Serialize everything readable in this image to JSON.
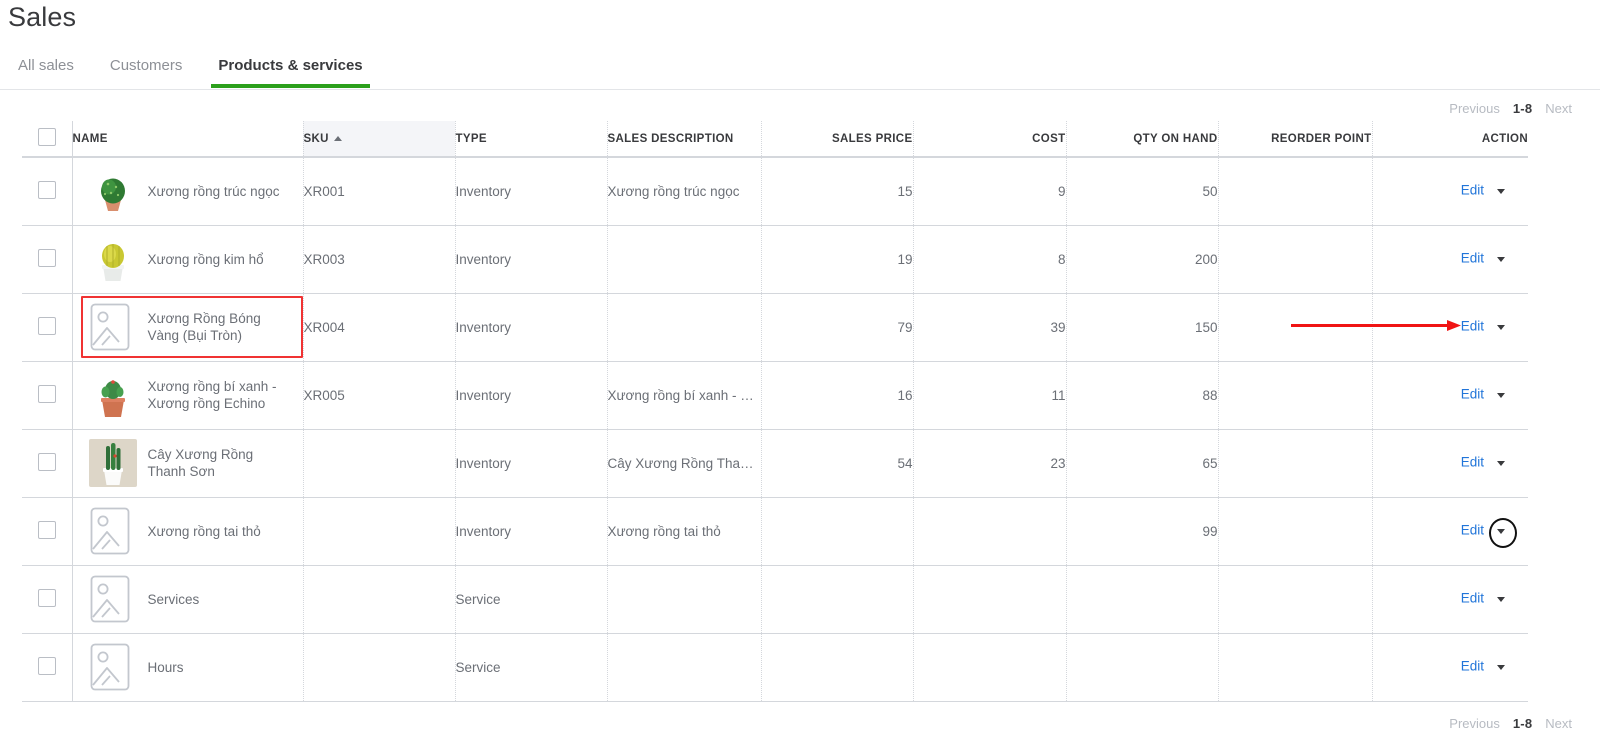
{
  "header": {
    "title": "Sales"
  },
  "tabs": [
    {
      "label": "All sales",
      "active": false
    },
    {
      "label": "Customers",
      "active": false
    },
    {
      "label": "Products & services",
      "active": true
    }
  ],
  "accent_color": "#2ca01c",
  "link_color": "#2175d9",
  "highlight_color": "#f03333",
  "pagination": {
    "previous": "Previous",
    "range": "1-8",
    "next": "Next"
  },
  "table": {
    "columns": [
      {
        "key": "name",
        "label": "NAME",
        "align": "left",
        "sorted": false
      },
      {
        "key": "sku",
        "label": "SKU",
        "align": "left",
        "sorted": true,
        "sort_dir": "asc"
      },
      {
        "key": "type",
        "label": "TYPE",
        "align": "left",
        "sorted": false
      },
      {
        "key": "description",
        "label": "SALES DESCRIPTION",
        "align": "left",
        "sorted": false
      },
      {
        "key": "price",
        "label": "SALES PRICE",
        "align": "right",
        "sorted": false
      },
      {
        "key": "cost",
        "label": "COST",
        "align": "right",
        "sorted": false
      },
      {
        "key": "qty",
        "label": "QTY ON HAND",
        "align": "right",
        "sorted": false
      },
      {
        "key": "reorder",
        "label": "REORDER POINT",
        "align": "right",
        "sorted": false
      },
      {
        "key": "action",
        "label": "ACTION",
        "align": "right",
        "sorted": false
      }
    ],
    "action_label": "Edit",
    "rows": [
      {
        "name": "Xương rồng trúc ngọc",
        "thumb": "cactus-green-ball",
        "sku": "XR001",
        "type": "Inventory",
        "description": "Xương rồng trúc ngọc",
        "price": "15",
        "cost": "9",
        "qty": "50",
        "reorder": "",
        "highlighted": false,
        "caret_ringed": false
      },
      {
        "name": "Xương rồng kim hổ",
        "thumb": "cactus-yellow-barrel",
        "sku": "XR003",
        "type": "Inventory",
        "description": "",
        "price": "19",
        "cost": "8",
        "qty": "200",
        "reorder": "",
        "highlighted": false,
        "caret_ringed": false
      },
      {
        "name": "Xương Rồng Bóng Vàng (Bụi Tròn)",
        "thumb": "placeholder-image",
        "sku": "XR004",
        "type": "Inventory",
        "description": "",
        "price": "79",
        "cost": "39",
        "qty": "150",
        "reorder": "",
        "highlighted": true,
        "caret_ringed": false
      },
      {
        "name": "Xương rồng bí xanh - Xương rồng Echino",
        "thumb": "cactus-terracotta-pot",
        "sku": "XR005",
        "type": "Inventory",
        "description": "Xương rồng bí xanh - …",
        "price": "16",
        "cost": "11",
        "qty": "88",
        "reorder": "",
        "highlighted": false,
        "caret_ringed": false
      },
      {
        "name": "Cây Xương Rồng Thanh Sơn",
        "thumb": "cactus-tall-white-pot",
        "sku": "",
        "type": "Inventory",
        "description": "Cây Xương Rồng Than…",
        "price": "54",
        "cost": "23",
        "qty": "65",
        "reorder": "",
        "highlighted": false,
        "caret_ringed": false
      },
      {
        "name": "Xương rồng tai thỏ",
        "thumb": "placeholder-image",
        "sku": "",
        "type": "Inventory",
        "description": "Xương rồng tai thỏ",
        "price": "",
        "cost": "",
        "qty": "99",
        "reorder": "",
        "highlighted": false,
        "caret_ringed": true
      },
      {
        "name": "Services",
        "thumb": "placeholder-image",
        "sku": "",
        "type": "Service",
        "description": "",
        "price": "",
        "cost": "",
        "qty": "",
        "reorder": "",
        "highlighted": false,
        "caret_ringed": false
      },
      {
        "name": "Hours",
        "thumb": "placeholder-image",
        "sku": "",
        "type": "Service",
        "description": "",
        "price": "",
        "cost": "",
        "qty": "",
        "reorder": "",
        "highlighted": false,
        "caret_ringed": false
      }
    ]
  },
  "annotations": {
    "arrow": {
      "color": "#f01414",
      "points_to": "Edit link of row 3"
    }
  }
}
